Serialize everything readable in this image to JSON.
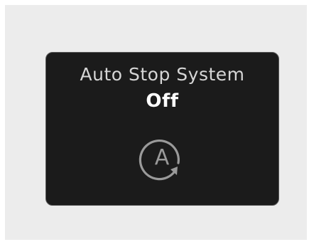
{
  "display": {
    "title": "Auto Stop System",
    "status": "Off",
    "icon": "auto-stop-icon",
    "icon_letter": "A",
    "colors": {
      "background": "#1b1b1b",
      "title_text": "#d6d6d6",
      "status_text": "#ffffff",
      "icon": "#9a9a9a"
    }
  }
}
